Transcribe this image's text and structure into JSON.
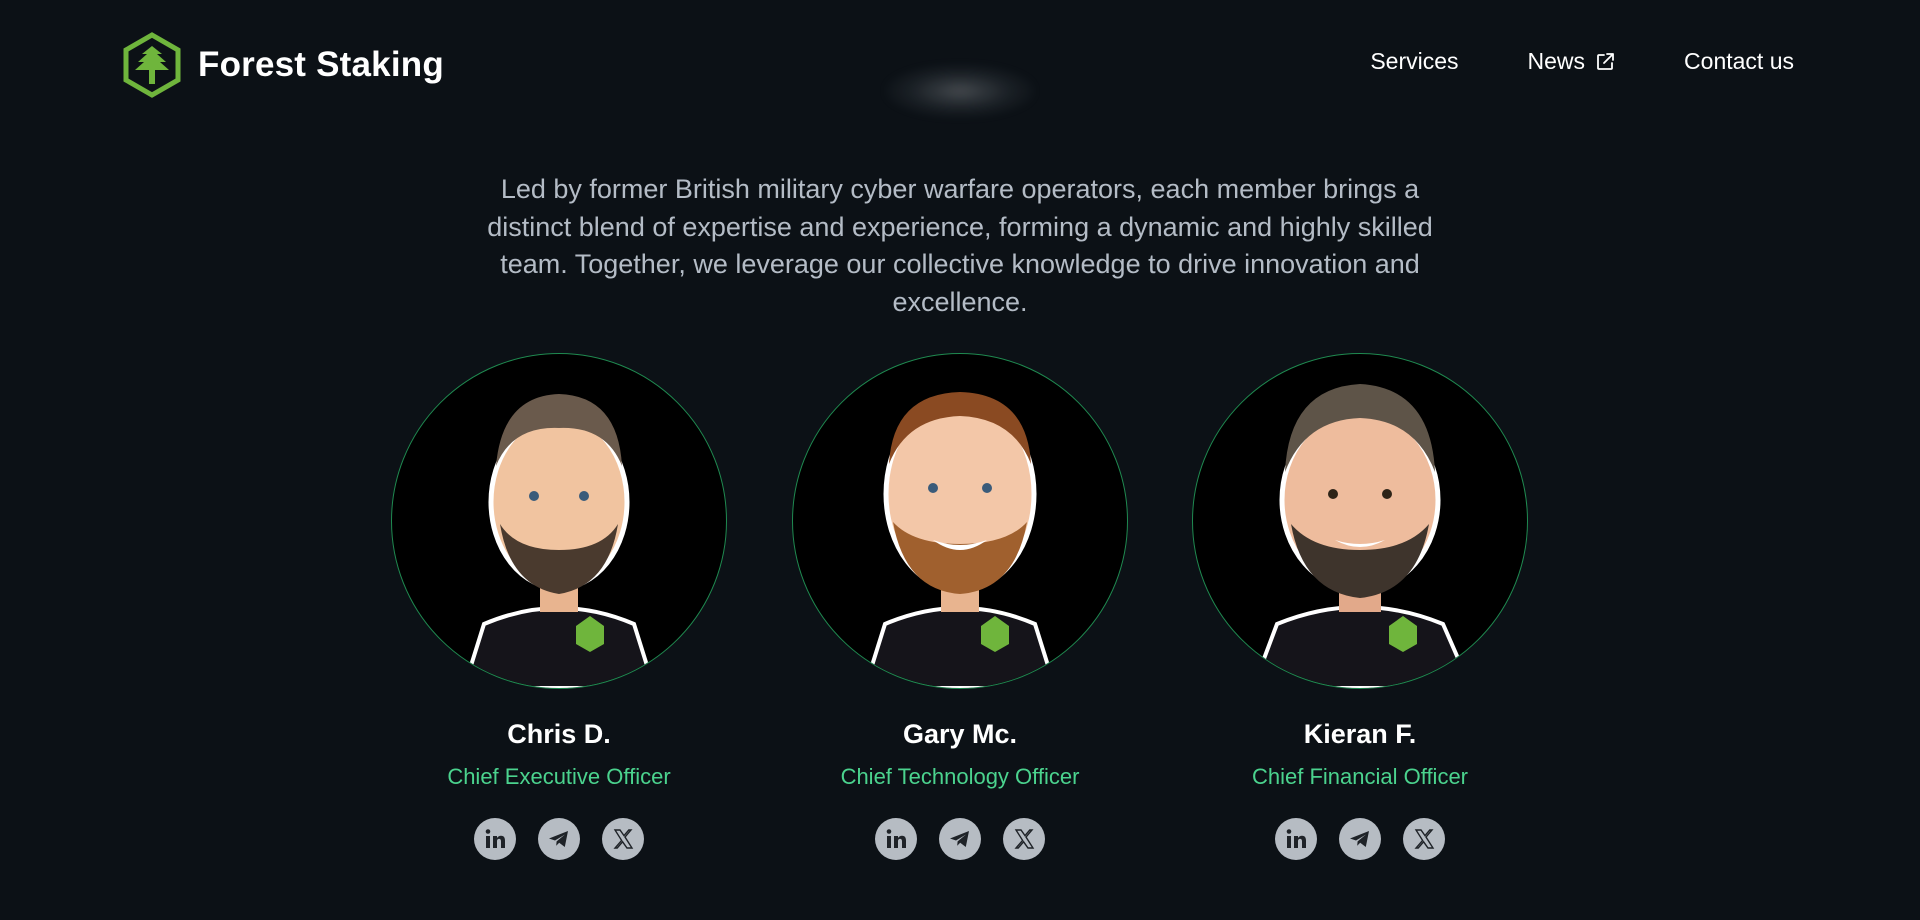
{
  "brand": {
    "name": "Forest Staking",
    "logo_icon": "forest-tree-logo-icon",
    "accent": "#6fb53c"
  },
  "nav": {
    "services": "Services",
    "news": "News",
    "news_icon": "external-link-icon",
    "contact": "Contact us"
  },
  "intro": {
    "text": "Led by former British military cyber warfare operators, each member brings a distinct blend of expertise and experience, forming a dynamic and highly skilled team. Together, we leverage our collective knowledge to drive innovation and excellence."
  },
  "team": [
    {
      "name": "Chris D.",
      "role": "Chief Executive Officer",
      "socials": [
        "linkedin-icon",
        "telegram-icon",
        "x-icon"
      ]
    },
    {
      "name": "Gary Mc.",
      "role": "Chief Technology Officer",
      "socials": [
        "linkedin-icon",
        "telegram-icon",
        "x-icon"
      ]
    },
    {
      "name": "Kieran F.",
      "role": "Chief Financial Officer",
      "socials": [
        "linkedin-icon",
        "telegram-icon",
        "x-icon"
      ]
    }
  ],
  "colors": {
    "background": "#0c1116",
    "role_text": "#4bd38e",
    "avatar_ring": "#1f8a50",
    "social_bg": "#b6bcc3"
  }
}
